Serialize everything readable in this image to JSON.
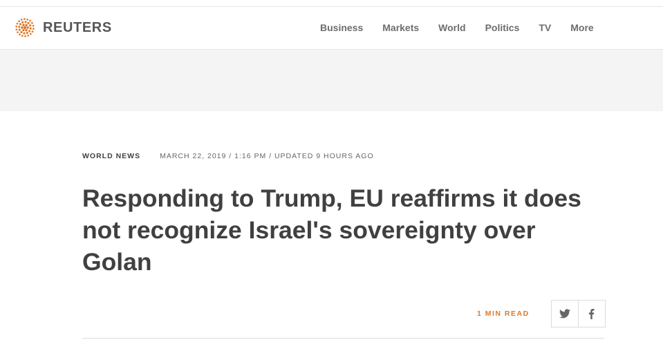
{
  "header": {
    "logo_text": "REUTERS",
    "nav": [
      {
        "label": "Business"
      },
      {
        "label": "Markets"
      },
      {
        "label": "World"
      },
      {
        "label": "Politics"
      },
      {
        "label": "TV"
      },
      {
        "label": "More"
      }
    ]
  },
  "article": {
    "section": "WORLD NEWS",
    "dateline": "MARCH 22, 2019 / 1:16 PM / UPDATED 9 HOURS AGO",
    "headline": "Responding to Trump, EU reaffirms it does not recognize Israel's sovereignty over Golan",
    "read_time": "1 MIN READ"
  },
  "share": {
    "buttons": [
      {
        "icon": "twitter-icon"
      },
      {
        "icon": "facebook-icon"
      }
    ]
  },
  "colors": {
    "brand_orange": "#e07825",
    "text": "#404040",
    "ad_band": "#f4f4f4"
  }
}
